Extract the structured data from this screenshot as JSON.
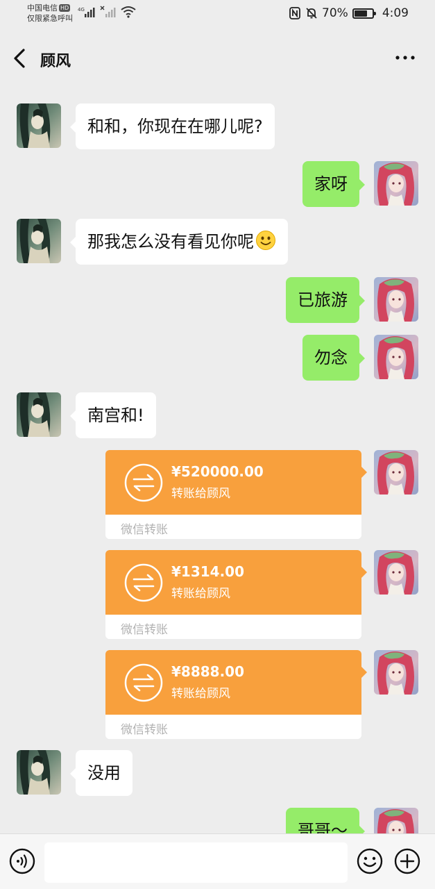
{
  "status_bar": {
    "carrier": "中国电信",
    "hd": "HD",
    "emergency": "仅限紧急呼叫",
    "network": "4G",
    "battery_percent": "70%",
    "battery_level": 0.7,
    "time": "4:09"
  },
  "header": {
    "title": "顾风"
  },
  "messages": [
    {
      "side": "in",
      "text": "和和，你现在在哪儿呢?"
    },
    {
      "side": "out",
      "text": "家呀"
    },
    {
      "side": "in",
      "text": "那我怎么没有看见你呢",
      "emoji": "smile-emoji"
    },
    {
      "side": "out",
      "text": "已旅游"
    },
    {
      "side": "out",
      "text": "勿念"
    },
    {
      "side": "in",
      "text": "南宫和!"
    },
    {
      "side": "out",
      "type": "transfer",
      "amount": "¥520000.00",
      "desc": "转账给顾风",
      "footer": "微信转账"
    },
    {
      "side": "out",
      "type": "transfer",
      "amount": "¥1314.00",
      "desc": "转账给顾风",
      "footer": "微信转账"
    },
    {
      "side": "out",
      "type": "transfer",
      "amount": "¥8888.00",
      "desc": "转账给顾风",
      "footer": "微信转账"
    },
    {
      "side": "in",
      "text": "没用"
    },
    {
      "side": "out",
      "text": "哥哥～"
    }
  ],
  "input_bar": {
    "text": "",
    "icons": [
      "voice-icon",
      "emoji-icon",
      "plus-icon"
    ]
  },
  "colors": {
    "background": "#ededed",
    "incoming_bubble": "#ffffff",
    "outgoing_bubble": "#95ec69",
    "transfer_card": "#f8a03d"
  }
}
